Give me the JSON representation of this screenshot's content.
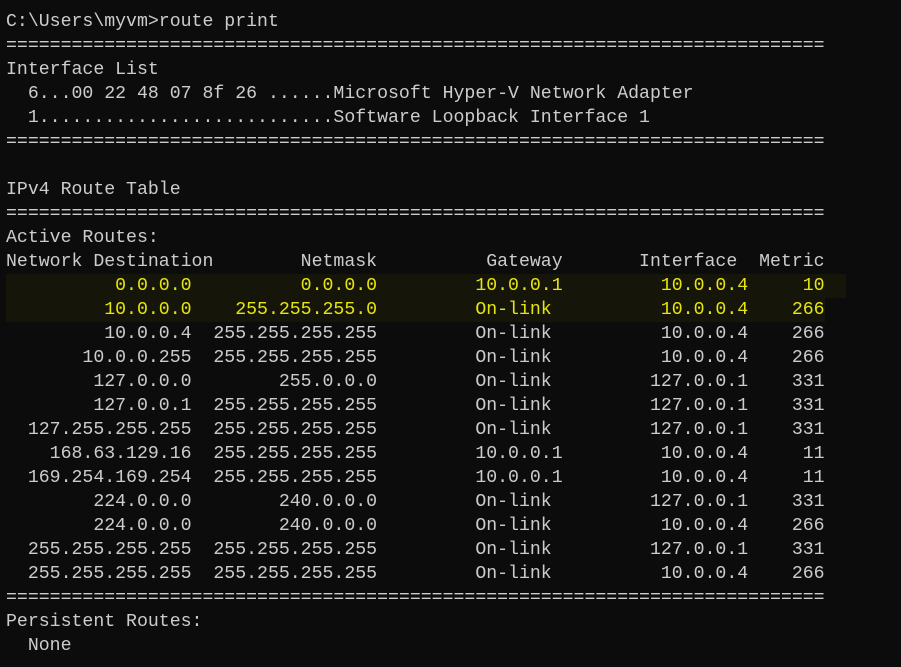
{
  "terminal": {
    "prompt": "C:\\Users\\myvm>route print",
    "separator": "===========================================================================",
    "interface_list": {
      "title": "Interface List",
      "entries": [
        "  6...00 22 48 07 8f 26 ......Microsoft Hyper-V Network Adapter",
        "  1...........................Software Loopback Interface 1"
      ]
    },
    "ipv4": {
      "title": "IPv4 Route Table",
      "active_routes_title": "Active Routes:",
      "columns": [
        "Network Destination",
        "Netmask",
        "Gateway",
        "Interface",
        "Metric"
      ],
      "header_line": "Network Destination        Netmask          Gateway       Interface  Metric",
      "rows": [
        {
          "destination": "0.0.0.0",
          "netmask": "0.0.0.0",
          "gateway": "10.0.0.1",
          "interface": "10.0.0.4",
          "metric": "10",
          "highlighted": true,
          "text": "          0.0.0.0          0.0.0.0         10.0.0.1         10.0.0.4     10"
        },
        {
          "destination": "10.0.0.0",
          "netmask": "255.255.255.0",
          "gateway": "On-link",
          "interface": "10.0.0.4",
          "metric": "266",
          "highlighted": true,
          "text": "         10.0.0.0    255.255.255.0         On-link          10.0.0.4    266"
        },
        {
          "destination": "10.0.0.4",
          "netmask": "255.255.255.255",
          "gateway": "On-link",
          "interface": "10.0.0.4",
          "metric": "266",
          "highlighted": false,
          "text": "         10.0.0.4  255.255.255.255         On-link          10.0.0.4    266"
        },
        {
          "destination": "10.0.0.255",
          "netmask": "255.255.255.255",
          "gateway": "On-link",
          "interface": "10.0.0.4",
          "metric": "266",
          "highlighted": false,
          "text": "       10.0.0.255  255.255.255.255         On-link          10.0.0.4    266"
        },
        {
          "destination": "127.0.0.0",
          "netmask": "255.0.0.0",
          "gateway": "On-link",
          "interface": "127.0.0.1",
          "metric": "331",
          "highlighted": false,
          "text": "        127.0.0.0        255.0.0.0         On-link         127.0.0.1    331"
        },
        {
          "destination": "127.0.0.1",
          "netmask": "255.255.255.255",
          "gateway": "On-link",
          "interface": "127.0.0.1",
          "metric": "331",
          "highlighted": false,
          "text": "        127.0.0.1  255.255.255.255         On-link         127.0.0.1    331"
        },
        {
          "destination": "127.255.255.255",
          "netmask": "255.255.255.255",
          "gateway": "On-link",
          "interface": "127.0.0.1",
          "metric": "331",
          "highlighted": false,
          "text": "  127.255.255.255  255.255.255.255         On-link         127.0.0.1    331"
        },
        {
          "destination": "168.63.129.16",
          "netmask": "255.255.255.255",
          "gateway": "10.0.0.1",
          "interface": "10.0.0.4",
          "metric": "11",
          "highlighted": false,
          "text": "    168.63.129.16  255.255.255.255         10.0.0.1         10.0.0.4     11"
        },
        {
          "destination": "169.254.169.254",
          "netmask": "255.255.255.255",
          "gateway": "10.0.0.1",
          "interface": "10.0.0.4",
          "metric": "11",
          "highlighted": false,
          "text": "  169.254.169.254  255.255.255.255         10.0.0.1         10.0.0.4     11"
        },
        {
          "destination": "224.0.0.0",
          "netmask": "240.0.0.0",
          "gateway": "On-link",
          "interface": "127.0.0.1",
          "metric": "331",
          "highlighted": false,
          "text": "        224.0.0.0        240.0.0.0         On-link         127.0.0.1    331"
        },
        {
          "destination": "224.0.0.0",
          "netmask": "240.0.0.0",
          "gateway": "On-link",
          "interface": "10.0.0.4",
          "metric": "266",
          "highlighted": false,
          "text": "        224.0.0.0        240.0.0.0         On-link          10.0.0.4    266"
        },
        {
          "destination": "255.255.255.255",
          "netmask": "255.255.255.255",
          "gateway": "On-link",
          "interface": "127.0.0.1",
          "metric": "331",
          "highlighted": false,
          "text": "  255.255.255.255  255.255.255.255         On-link         127.0.0.1    331"
        },
        {
          "destination": "255.255.255.255",
          "netmask": "255.255.255.255",
          "gateway": "On-link",
          "interface": "10.0.0.4",
          "metric": "266",
          "highlighted": false,
          "text": "  255.255.255.255  255.255.255.255         On-link          10.0.0.4    266"
        }
      ],
      "persistent_routes_title": "Persistent Routes:",
      "persistent_routes_value": "  None"
    },
    "colors": {
      "background": "#0c0c0c",
      "text": "#cccccc",
      "highlight_text": "#e5e510",
      "highlight_background": "#15150a"
    }
  }
}
